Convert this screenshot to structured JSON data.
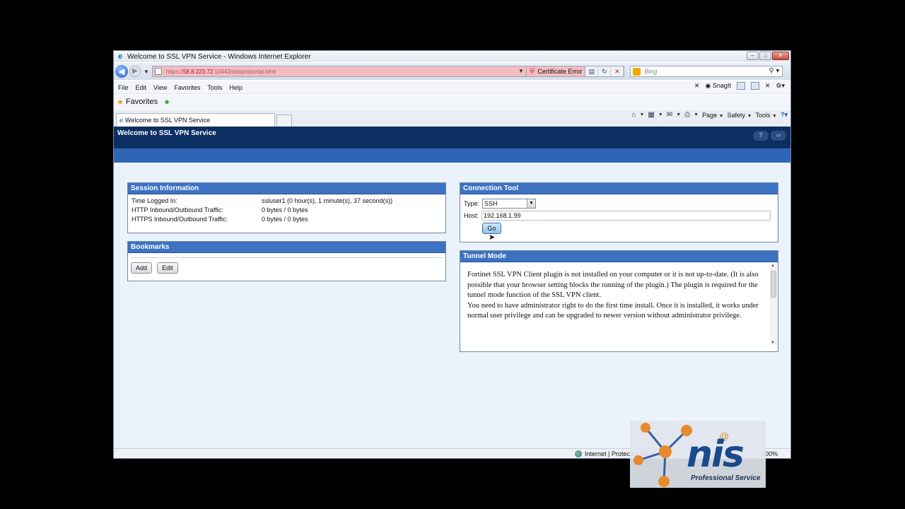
{
  "window": {
    "title": "Welcome to SSL VPN Service - Windows Internet Explorer"
  },
  "address": {
    "prefix": "https://",
    "host": "58.8.223.72",
    "rest": ":10443/sslvpn/portal.html",
    "cert_error": "Certificate Error"
  },
  "search": {
    "placeholder": "Bing"
  },
  "menu": {
    "items": [
      "File",
      "Edit",
      "View",
      "Favorites",
      "Tools",
      "Help"
    ],
    "snagit": "SnagIt"
  },
  "favorites": {
    "label": "Favorites"
  },
  "tab": {
    "title": "Welcome to SSL VPN Service"
  },
  "commandbar": {
    "page": "Page",
    "safety": "Safety",
    "tools": "Tools"
  },
  "page": {
    "header_title": "Welcome to SSL VPN Service",
    "header_buttons": [
      "?",
      "⇨"
    ]
  },
  "session": {
    "title": "Session Information",
    "rows": [
      {
        "label": "Time Logged In:",
        "value": "ssluser1 (0 hour(s), 1 minute(s), 37 second(s))"
      },
      {
        "label": "HTTP Inbound/Outbound Traffic:",
        "value": "0 bytes / 0 bytes"
      },
      {
        "label": "HTTPS Inbound/Outbound Traffic:",
        "value": "0 bytes / 0 bytes"
      }
    ]
  },
  "bookmarks": {
    "title": "Bookmarks",
    "add": "Add",
    "edit": "Edit"
  },
  "connection": {
    "title": "Connection Tool",
    "type_label": "Type:",
    "type_value": "SSH",
    "host_label": "Host:",
    "host_value": "192.168.1.99",
    "go": "Go"
  },
  "tunnel": {
    "title": "Tunnel Mode",
    "message": "Fortinet SSL VPN Client plugin is not installed on your computer or it is not up-to-date. (It is also possible that your browser setting blocks the running of the plugin.) The plugin is required for the tunnel mode function of the SSL VPN client.",
    "message2": "You need to have administrator right to do the first time install. Once it is installed, it works under normal user privilege and can be upgraded to newer version without administrator privilege."
  },
  "status": {
    "zone": "Internet | Protected Mode: On",
    "zoom": "100%"
  },
  "watermark": {
    "brand": "nis",
    "tagline": "Professional Service"
  }
}
